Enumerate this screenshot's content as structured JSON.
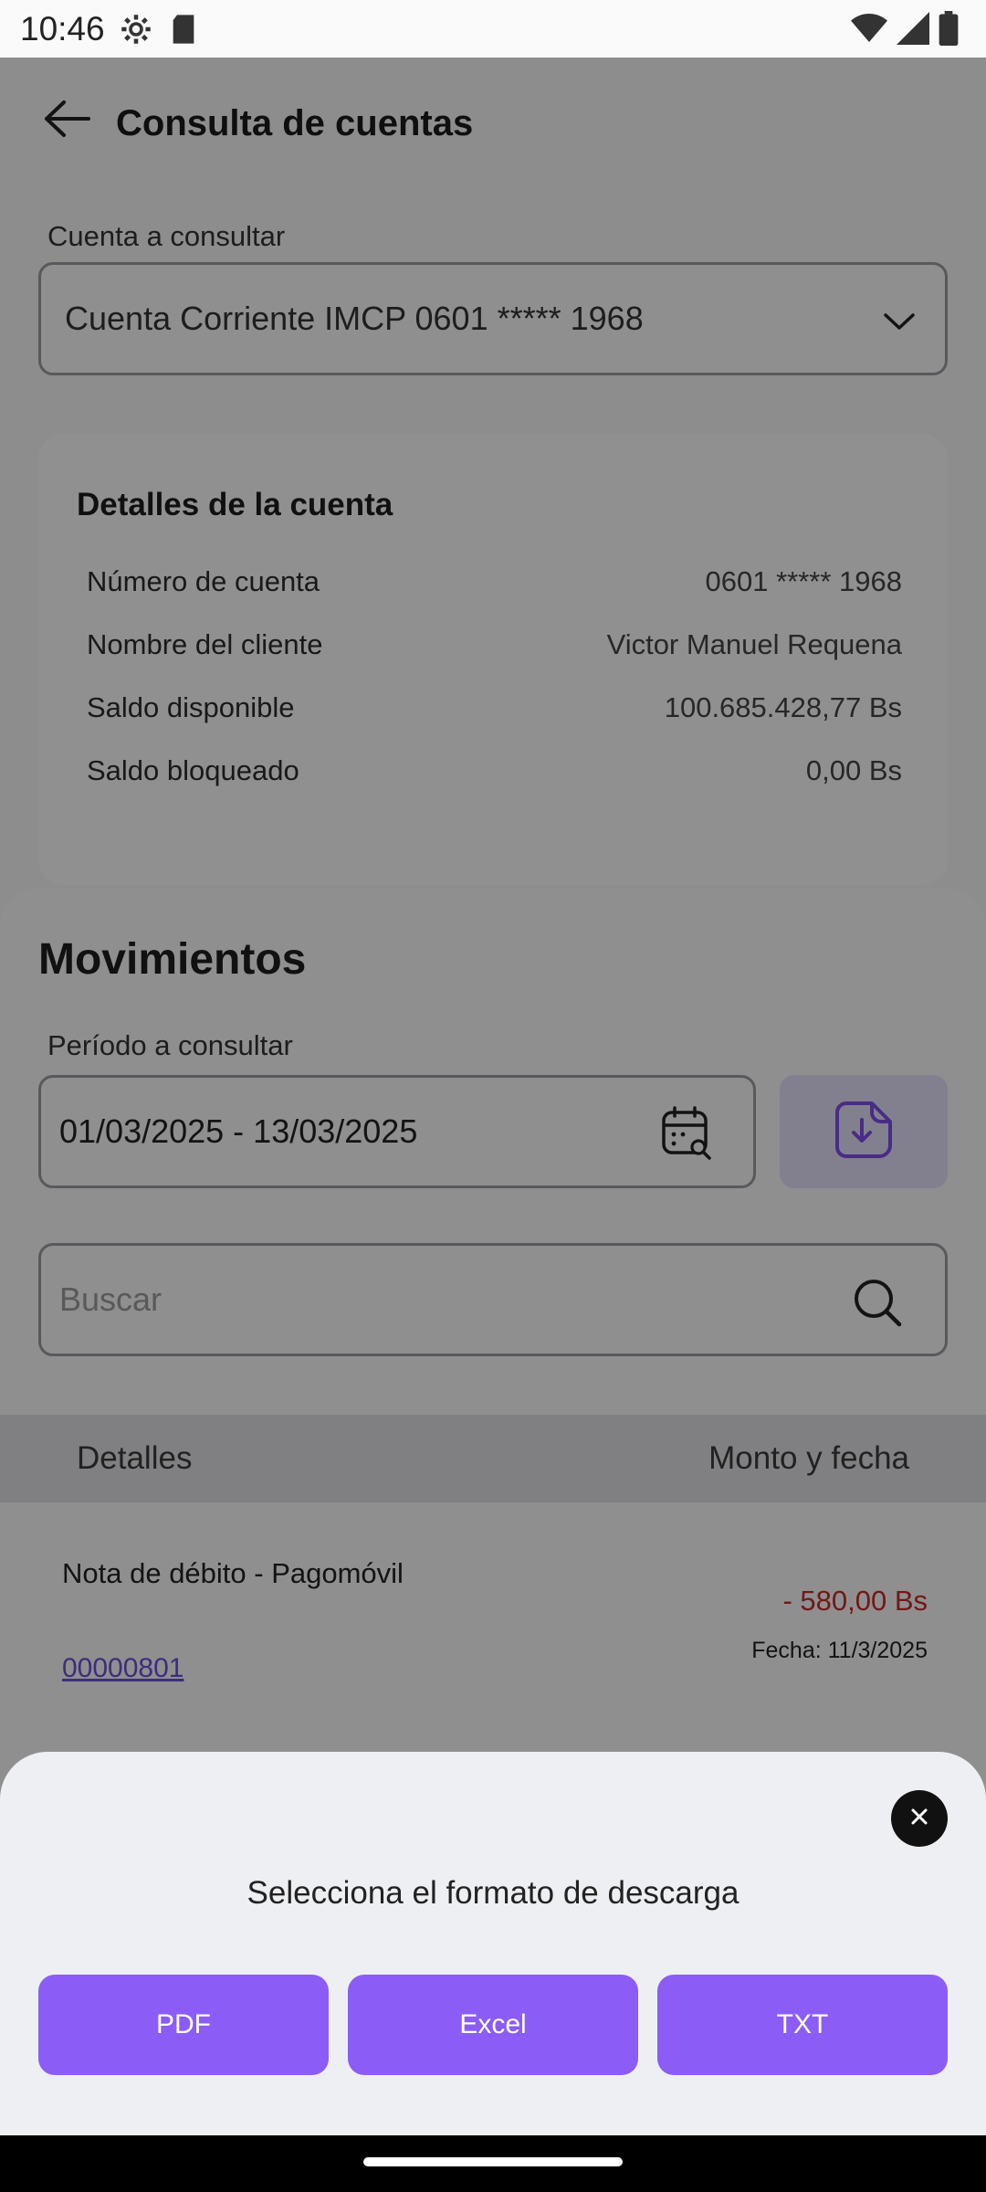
{
  "status_bar": {
    "time": "10:46",
    "icons": [
      "settings-gear-icon",
      "sd-card-icon",
      "wifi-icon",
      "signal-icon",
      "battery-icon"
    ]
  },
  "app_bar": {
    "title": "Consulta de cuentas",
    "back_icon": "arrow-left-icon"
  },
  "account_select": {
    "label": "Cuenta a consultar",
    "value": "Cuenta Corriente IMCP 0601 ***** 1968"
  },
  "account_details": {
    "title": "Detalles de la cuenta",
    "rows": [
      {
        "label": "Número de cuenta",
        "value": "0601 ***** 1968"
      },
      {
        "label": "Nombre del cliente",
        "value": "Victor Manuel Requena"
      },
      {
        "label": "Saldo disponible",
        "value": "100.685.428,77 Bs"
      },
      {
        "label": "Saldo bloqueado",
        "value": "0,00 Bs"
      }
    ]
  },
  "movements": {
    "title": "Movimientos",
    "period_label": "Período a consultar",
    "period_value": "01/03/2025 - 13/03/2025",
    "search_placeholder": "Buscar",
    "table_headers": {
      "left": "Detalles",
      "right": "Monto y fecha"
    },
    "transactions": [
      {
        "description": "Nota de débito - Pagomóvil",
        "reference": "00000801",
        "amount": "- 580,00 Bs",
        "date": "Fecha: 11/3/2025"
      }
    ]
  },
  "download_sheet": {
    "title": "Selecciona el formato de descarga",
    "buttons": [
      "PDF",
      "Excel",
      "TXT"
    ]
  },
  "colors": {
    "accent": "#8b5cf6",
    "debit": "#c62828",
    "link": "#6b4fd8"
  }
}
